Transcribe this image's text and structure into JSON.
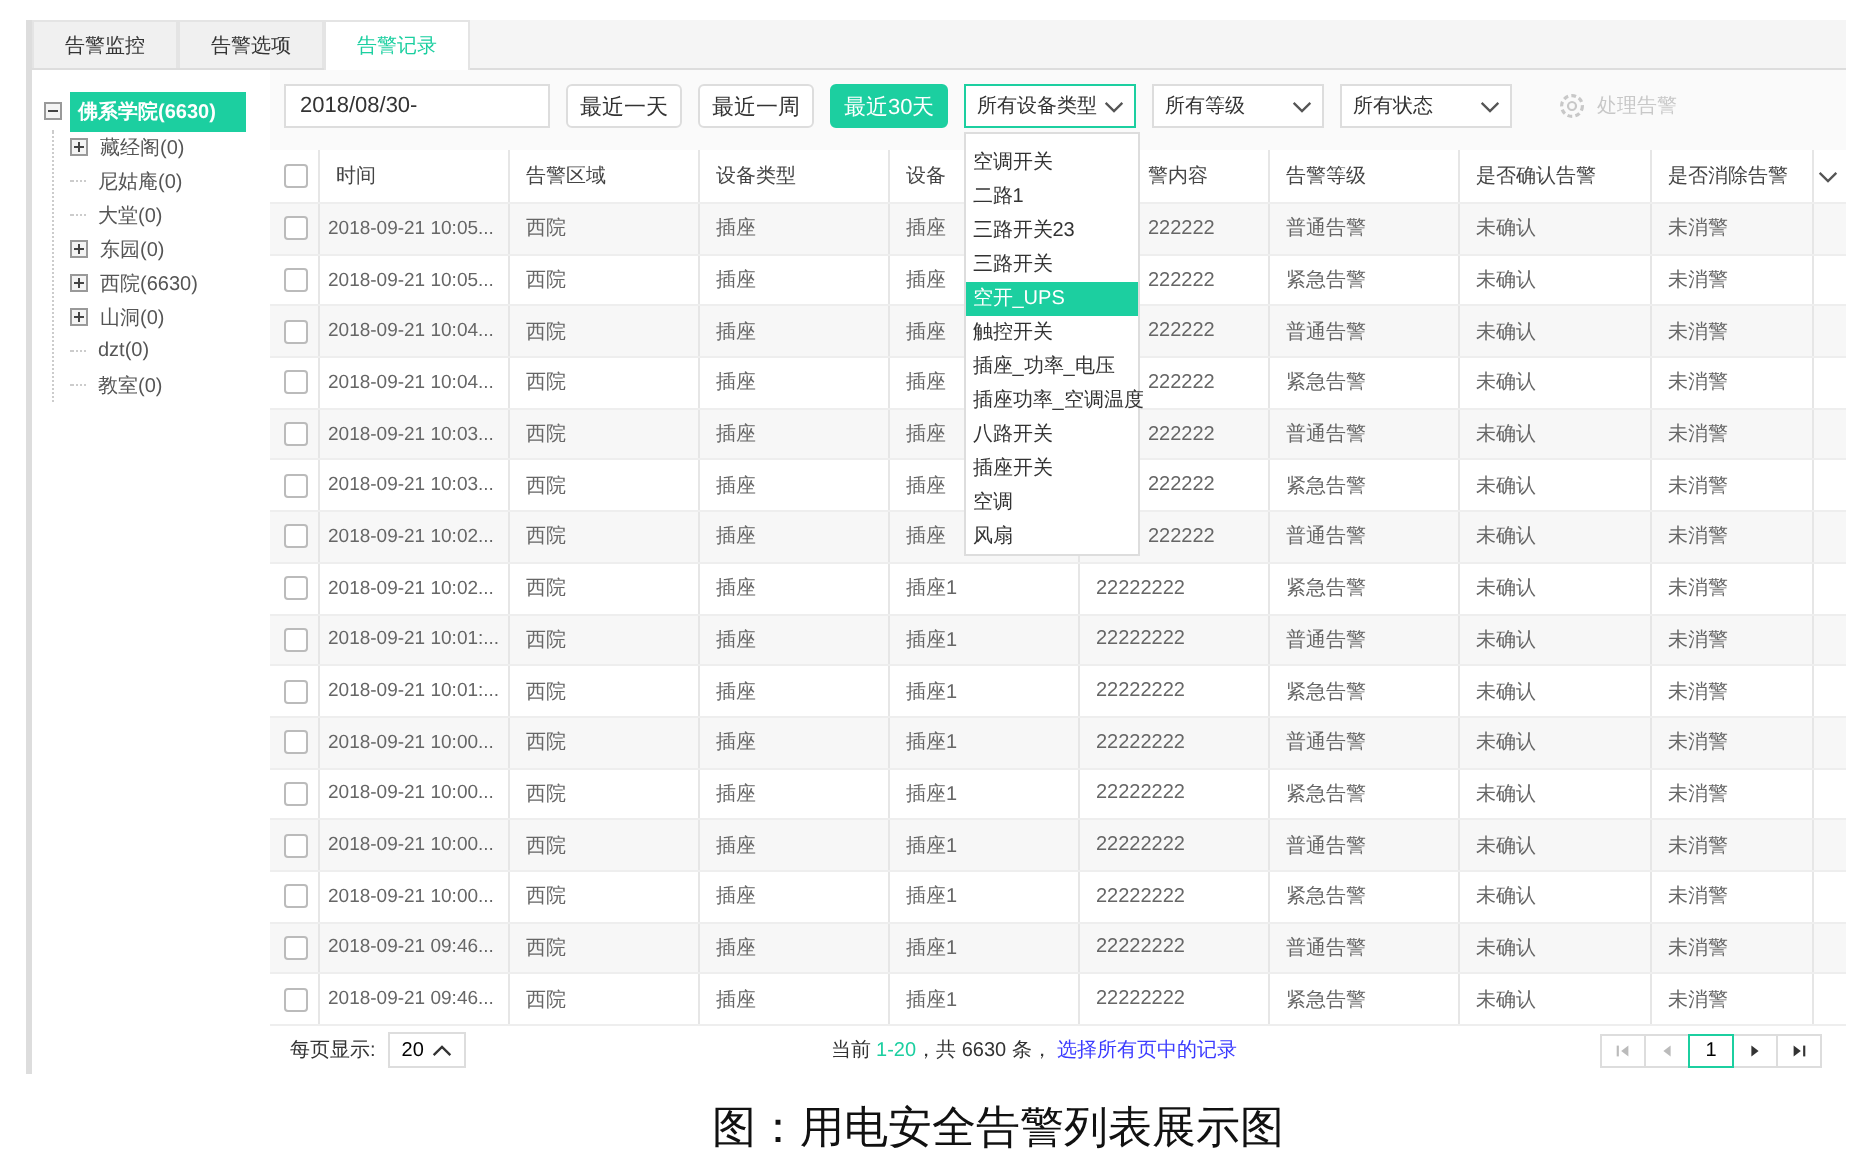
{
  "tabs": [
    {
      "label": "告警监控",
      "selected": false
    },
    {
      "label": "告警选项",
      "selected": false
    },
    {
      "label": "告警记录",
      "selected": true
    }
  ],
  "tree": [
    {
      "label": "佛系学院(6630)",
      "selected": true,
      "expanded": true,
      "children": [
        {
          "label": "藏经阁(0)",
          "selected": false,
          "expanded": false
        },
        {
          "label": "尼姑庵(0)",
          "selected": false
        },
        {
          "label": "大堂(0)",
          "selected": false
        },
        {
          "label": "东园(0)",
          "selected": false,
          "expanded": false
        },
        {
          "label": "西院(6630)",
          "selected": false,
          "expanded": false
        },
        {
          "label": "山洞(0)",
          "selected": false,
          "expanded": false
        },
        {
          "label": "dzt(0)",
          "selected": false
        },
        {
          "label": "教室(0)",
          "selected": false
        }
      ]
    }
  ],
  "toolbar": {
    "date_range": "2018/08/30-",
    "quick_ranges": [
      {
        "label": "最近一天",
        "selected": false
      },
      {
        "label": "最近一周",
        "selected": false
      },
      {
        "label": "最近30天",
        "selected": true
      }
    ],
    "filters": [
      {
        "value": "所有设备类型",
        "open": true
      },
      {
        "value": "所有等级",
        "open": false
      },
      {
        "value": "所有状态",
        "open": false
      }
    ],
    "process_button": {
      "label": "处理告警",
      "disabled": true
    }
  },
  "device_type_options": [
    {
      "label": "空调开关",
      "selected": false
    },
    {
      "label": "二路1",
      "selected": false
    },
    {
      "label": "三路开关23",
      "selected": false
    },
    {
      "label": "三路开关",
      "selected": false
    },
    {
      "label": "空开_UPS",
      "selected": true
    },
    {
      "label": "触控开关",
      "selected": false
    },
    {
      "label": "插座_功率_电压",
      "selected": false
    },
    {
      "label": "插座功率_空调温度",
      "selected": false
    },
    {
      "label": "八路开关",
      "selected": false
    },
    {
      "label": "插座开关",
      "selected": false
    },
    {
      "label": "空调",
      "selected": false
    },
    {
      "label": "风扇",
      "selected": false
    }
  ],
  "table": {
    "all_checked": false,
    "columns": [
      {
        "label": "时间"
      },
      {
        "label": "告警区域"
      },
      {
        "label": "设备类型"
      },
      {
        "label": "设备"
      },
      {
        "label": "警内容",
        "clipped": true
      },
      {
        "label": "告警等级"
      },
      {
        "label": "是否确认告警"
      },
      {
        "label": "是否消除告警"
      }
    ],
    "rows": [
      {
        "checked": false,
        "cells": [
          {
            "text": "2018-09-21 10:05..."
          },
          {
            "text": "西院"
          },
          {
            "text": "插座"
          },
          {
            "text": "插座"
          },
          {
            "text": "222222",
            "clipped": true
          },
          {
            "text": "普通告警"
          },
          {
            "text": "未确认"
          },
          {
            "text": "未消警"
          }
        ]
      },
      {
        "checked": false,
        "cells": [
          {
            "text": "2018-09-21 10:05..."
          },
          {
            "text": "西院"
          },
          {
            "text": "插座"
          },
          {
            "text": "插座"
          },
          {
            "text": "222222",
            "clipped": true
          },
          {
            "text": "紧急告警"
          },
          {
            "text": "未确认"
          },
          {
            "text": "未消警"
          }
        ]
      },
      {
        "checked": false,
        "cells": [
          {
            "text": "2018-09-21 10:04..."
          },
          {
            "text": "西院"
          },
          {
            "text": "插座"
          },
          {
            "text": "插座"
          },
          {
            "text": "222222",
            "clipped": true
          },
          {
            "text": "普通告警"
          },
          {
            "text": "未确认"
          },
          {
            "text": "未消警"
          }
        ]
      },
      {
        "checked": false,
        "cells": [
          {
            "text": "2018-09-21 10:04..."
          },
          {
            "text": "西院"
          },
          {
            "text": "插座"
          },
          {
            "text": "插座"
          },
          {
            "text": "222222",
            "clipped": true
          },
          {
            "text": "紧急告警"
          },
          {
            "text": "未确认"
          },
          {
            "text": "未消警"
          }
        ]
      },
      {
        "checked": false,
        "cells": [
          {
            "text": "2018-09-21 10:03..."
          },
          {
            "text": "西院"
          },
          {
            "text": "插座"
          },
          {
            "text": "插座"
          },
          {
            "text": "222222",
            "clipped": true
          },
          {
            "text": "普通告警"
          },
          {
            "text": "未确认"
          },
          {
            "text": "未消警"
          }
        ]
      },
      {
        "checked": false,
        "cells": [
          {
            "text": "2018-09-21 10:03..."
          },
          {
            "text": "西院"
          },
          {
            "text": "插座"
          },
          {
            "text": "插座"
          },
          {
            "text": "222222",
            "clipped": true
          },
          {
            "text": "紧急告警"
          },
          {
            "text": "未确认"
          },
          {
            "text": "未消警"
          }
        ]
      },
      {
        "checked": false,
        "cells": [
          {
            "text": "2018-09-21 10:02..."
          },
          {
            "text": "西院"
          },
          {
            "text": "插座"
          },
          {
            "text": "插座"
          },
          {
            "text": "222222",
            "clipped": true
          },
          {
            "text": "普通告警"
          },
          {
            "text": "未确认"
          },
          {
            "text": "未消警"
          }
        ]
      },
      {
        "checked": false,
        "cells": [
          {
            "text": "2018-09-21 10:02..."
          },
          {
            "text": "西院"
          },
          {
            "text": "插座"
          },
          {
            "text": "插座1"
          },
          {
            "text": "22222222"
          },
          {
            "text": "紧急告警"
          },
          {
            "text": "未确认"
          },
          {
            "text": "未消警"
          }
        ]
      },
      {
        "checked": false,
        "cells": [
          {
            "text": "2018-09-21 10:01:..."
          },
          {
            "text": "西院"
          },
          {
            "text": "插座"
          },
          {
            "text": "插座1"
          },
          {
            "text": "22222222"
          },
          {
            "text": "普通告警"
          },
          {
            "text": "未确认"
          },
          {
            "text": "未消警"
          }
        ]
      },
      {
        "checked": false,
        "cells": [
          {
            "text": "2018-09-21 10:01:..."
          },
          {
            "text": "西院"
          },
          {
            "text": "插座"
          },
          {
            "text": "插座1"
          },
          {
            "text": "22222222"
          },
          {
            "text": "紧急告警"
          },
          {
            "text": "未确认"
          },
          {
            "text": "未消警"
          }
        ]
      },
      {
        "checked": false,
        "cells": [
          {
            "text": "2018-09-21 10:00..."
          },
          {
            "text": "西院"
          },
          {
            "text": "插座"
          },
          {
            "text": "插座1"
          },
          {
            "text": "22222222"
          },
          {
            "text": "普通告警"
          },
          {
            "text": "未确认"
          },
          {
            "text": "未消警"
          }
        ]
      },
      {
        "checked": false,
        "cells": [
          {
            "text": "2018-09-21 10:00..."
          },
          {
            "text": "西院"
          },
          {
            "text": "插座"
          },
          {
            "text": "插座1"
          },
          {
            "text": "22222222"
          },
          {
            "text": "紧急告警"
          },
          {
            "text": "未确认"
          },
          {
            "text": "未消警"
          }
        ]
      },
      {
        "checked": false,
        "cells": [
          {
            "text": "2018-09-21 10:00..."
          },
          {
            "text": "西院"
          },
          {
            "text": "插座"
          },
          {
            "text": "插座1"
          },
          {
            "text": "22222222"
          },
          {
            "text": "普通告警"
          },
          {
            "text": "未确认"
          },
          {
            "text": "未消警"
          }
        ]
      },
      {
        "checked": false,
        "cells": [
          {
            "text": "2018-09-21 10:00..."
          },
          {
            "text": "西院"
          },
          {
            "text": "插座"
          },
          {
            "text": "插座1"
          },
          {
            "text": "22222222"
          },
          {
            "text": "紧急告警"
          },
          {
            "text": "未确认"
          },
          {
            "text": "未消警"
          }
        ]
      },
      {
        "checked": false,
        "cells": [
          {
            "text": "2018-09-21 09:46..."
          },
          {
            "text": "西院"
          },
          {
            "text": "插座"
          },
          {
            "text": "插座1"
          },
          {
            "text": "22222222"
          },
          {
            "text": "普通告警"
          },
          {
            "text": "未确认"
          },
          {
            "text": "未消警"
          }
        ]
      },
      {
        "checked": false,
        "cells": [
          {
            "text": "2018-09-21 09:46..."
          },
          {
            "text": "西院"
          },
          {
            "text": "插座"
          },
          {
            "text": "插座1"
          },
          {
            "text": "22222222"
          },
          {
            "text": "紧急告警"
          },
          {
            "text": "未确认"
          },
          {
            "text": "未消警"
          }
        ]
      }
    ]
  },
  "footer": {
    "page_size_label": "每页显示:",
    "page_size": "20",
    "range_prefix": "当前 ",
    "range": "1-20",
    "range_suffix": "，共 6630 条，",
    "select_all_link": "选择所有页中的记录",
    "pages": [
      {
        "label": "1",
        "selected": true
      }
    ]
  },
  "caption": "图：用电安全告警列表展示图"
}
